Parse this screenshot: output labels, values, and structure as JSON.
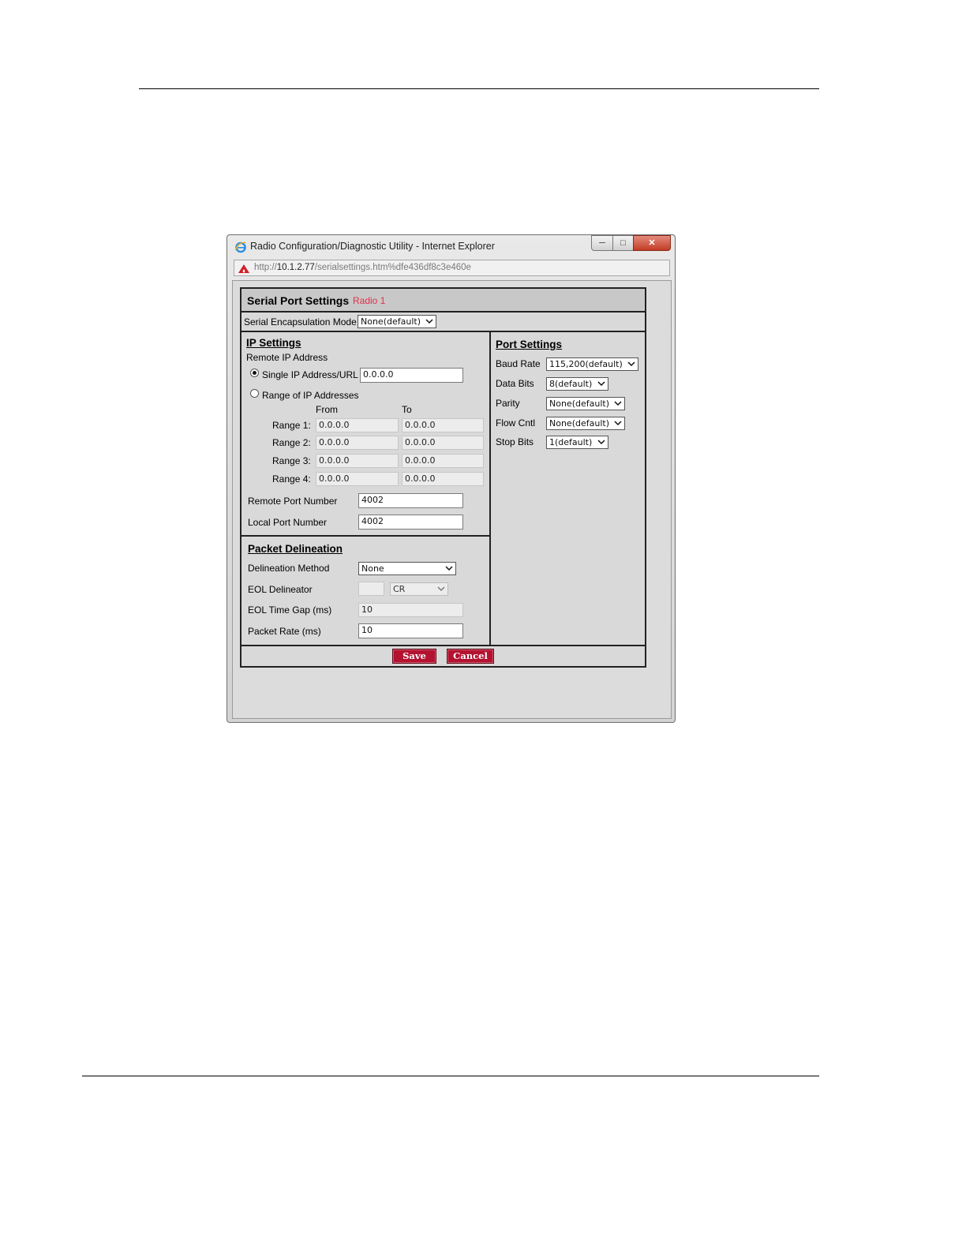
{
  "window": {
    "title": "Radio Configuration/Diagnostic Utility - Internet Explorer",
    "url_prefix": "http://",
    "url_host": "10.1.2.77",
    "url_path": "/serialsettings.htm%dfe436df8c3e460e"
  },
  "panel": {
    "title": "Serial Port Settings",
    "radio_label": "Radio 1",
    "encapsulation_label": "Serial Encapsulation Mode",
    "encapsulation_value": "None(default)"
  },
  "ip_settings": {
    "heading": "IP Settings",
    "remote_ip_label": "Remote IP Address",
    "single_label": "Single IP Address/URL",
    "single_value": "0.0.0.0",
    "range_label": "Range of IP Addresses",
    "from_label": "From",
    "to_label": "To",
    "ranges": [
      {
        "label": "Range 1:",
        "from": "0.0.0.0",
        "to": "0.0.0.0"
      },
      {
        "label": "Range 2:",
        "from": "0.0.0.0",
        "to": "0.0.0.0"
      },
      {
        "label": "Range 3:",
        "from": "0.0.0.0",
        "to": "0.0.0.0"
      },
      {
        "label": "Range 4:",
        "from": "0.0.0.0",
        "to": "0.0.0.0"
      }
    ],
    "remote_port_label": "Remote Port Number",
    "remote_port_value": "4002",
    "local_port_label": "Local Port Number",
    "local_port_value": "4002"
  },
  "packet": {
    "heading": "Packet Delineation",
    "method_label": "Delineation Method",
    "method_value": "None",
    "eol_label": "EOL Delineator",
    "eol_char_value": "",
    "eol_select_value": "CR",
    "gap_label": "EOL Time Gap (ms)",
    "gap_value": "10",
    "rate_label": "Packet Rate (ms)",
    "rate_value": "10"
  },
  "port_settings": {
    "heading": "Port Settings",
    "baud_label": "Baud Rate",
    "baud_value": "115,200(default)",
    "data_bits_label": "Data Bits",
    "data_bits_value": "8(default)",
    "parity_label": "Parity",
    "parity_value": "None(default)",
    "flow_label": "Flow Cntl",
    "flow_value": "None(default)",
    "stop_label": "Stop Bits",
    "stop_value": "1(default)"
  },
  "buttons": {
    "save": "Save",
    "cancel": "Cancel"
  },
  "icons": {
    "browser": "internet-explorer-icon",
    "site": "warning-triangle-icon",
    "dropdown": "chevron-down-icon"
  },
  "colors": {
    "button_red": "#b31230",
    "radio_label": "#e0304a"
  }
}
